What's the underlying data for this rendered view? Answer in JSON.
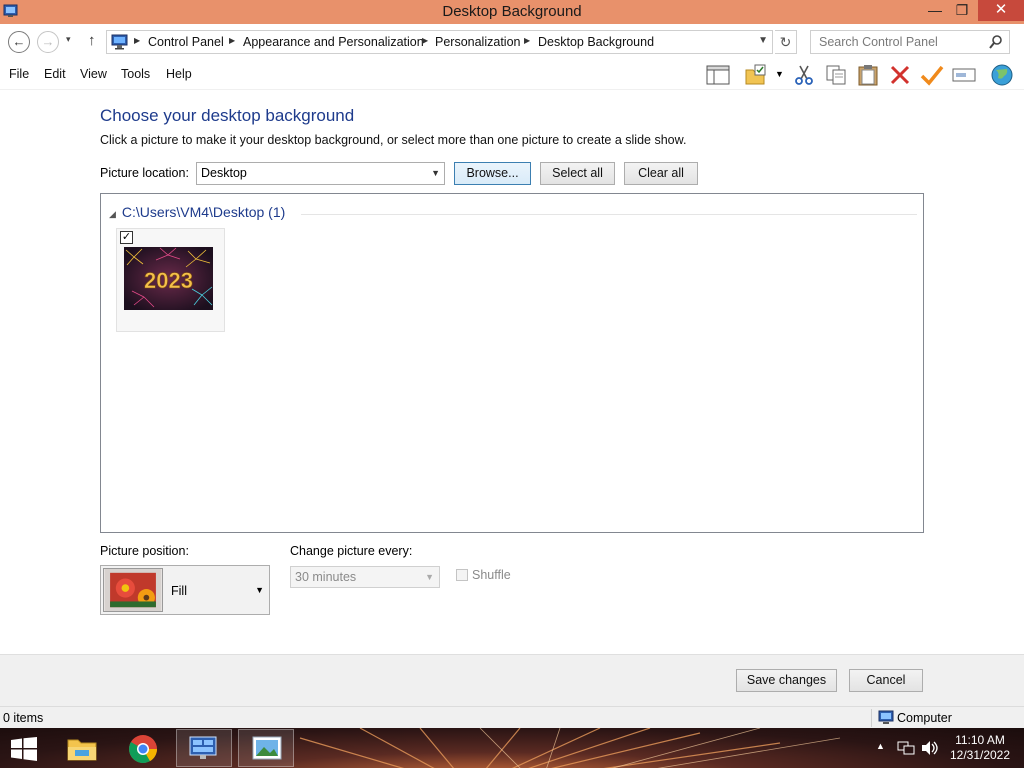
{
  "window": {
    "title": "Desktop Background",
    "minimize_glyph": "—",
    "maximize_glyph": "❐",
    "close_glyph": "✕"
  },
  "address_bar": {
    "back_glyph": "←",
    "forward_glyph": "→",
    "history_glyph": "▾",
    "up_glyph": "↑",
    "refresh_glyph": "↻",
    "breadcrumbs": [
      "Control Panel",
      "Appearance and Personalization",
      "Personalization",
      "Desktop Background"
    ],
    "search_placeholder": "Search Control Panel"
  },
  "menu": {
    "items": [
      "File",
      "Edit",
      "View",
      "Tools",
      "Help"
    ],
    "toolbar_icons": [
      "layout-pane-icon",
      "folder-properties-icon",
      "cut-icon",
      "copy-icon",
      "paste-icon",
      "delete-icon",
      "check-icon",
      "rename-icon",
      "globe-icon"
    ]
  },
  "content": {
    "heading": "Choose your desktop background",
    "description": "Click a picture to make it your desktop background, or select more than one picture to create a slide show.",
    "location_label": "Picture location:",
    "location_value": "Desktop",
    "browse_label": "Browse...",
    "select_all_label": "Select all",
    "clear_all_label": "Clear all",
    "group_header": "C:\\Users\\VM4\\Desktop (1)",
    "pictures": [
      {
        "checked": true,
        "thumb_text": "2023"
      }
    ],
    "position_label": "Picture position:",
    "position_value": "Fill",
    "change_label": "Change picture every:",
    "change_value": "30 minutes",
    "shuffle_label": "Shuffle"
  },
  "footer": {
    "save_label": "Save changes",
    "cancel_label": "Cancel"
  },
  "status": {
    "items_text": "0 items",
    "location_text": "Computer"
  },
  "taskbar": {
    "apps": [
      "file-explorer",
      "chrome",
      "control-panel",
      "photos"
    ],
    "tray_arrow": "▲",
    "time": "11:10 AM",
    "date": "12/31/2022"
  }
}
